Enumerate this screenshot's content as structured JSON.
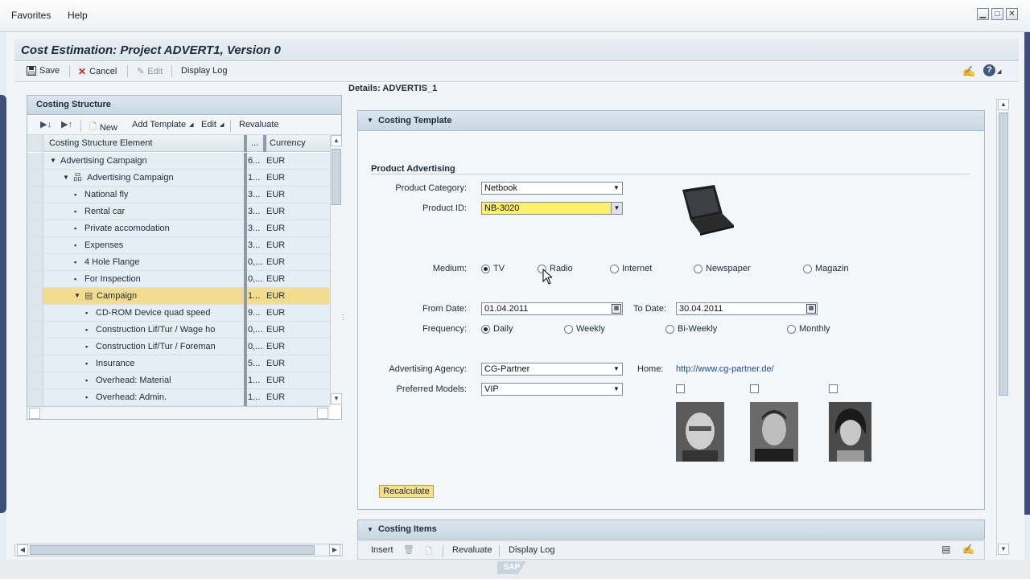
{
  "menu": {
    "favorites": "Favorites",
    "help": "Help"
  },
  "window_controls": {
    "minimize": "▁",
    "maximize": "□",
    "close": "✕"
  },
  "app": {
    "title": "Cost Estimation: Project ADVERT1, Version 0"
  },
  "toolbar": {
    "save": "Save",
    "cancel": "Cancel",
    "edit": "Edit",
    "display_log": "Display Log"
  },
  "costing_structure": {
    "title": "Costing Structure",
    "toolbar": {
      "new": "New",
      "add_template": "Add Template",
      "edit": "Edit",
      "revaluate": "Revaluate"
    },
    "columns": {
      "element": "Costing Structure Element",
      "dots": "...",
      "currency": "Currency"
    },
    "rows": [
      {
        "label": "Advertising Campaign",
        "val": "6...",
        "cur": "EUR"
      },
      {
        "label": "Advertising Campaign",
        "val": "1...",
        "cur": "EUR"
      },
      {
        "label": "National fly",
        "val": "3...",
        "cur": "EUR"
      },
      {
        "label": "Rental car",
        "val": "3...",
        "cur": "EUR"
      },
      {
        "label": "Private accomodation",
        "val": "3...",
        "cur": "EUR"
      },
      {
        "label": "Expenses",
        "val": "3...",
        "cur": "EUR"
      },
      {
        "label": "4 Hole Flange",
        "val": "0,...",
        "cur": "EUR"
      },
      {
        "label": "For Inspection",
        "val": "0,...",
        "cur": "EUR"
      },
      {
        "label": "Campaign",
        "val": "1...",
        "cur": "EUR"
      },
      {
        "label": "CD-ROM Device quad speed",
        "val": "9...",
        "cur": "EUR"
      },
      {
        "label": "Construction Lif/Tur / Wage ho",
        "val": "0,...",
        "cur": "EUR"
      },
      {
        "label": "Construction Lif/Tur / Foreman",
        "val": "0,...",
        "cur": "EUR"
      },
      {
        "label": "Insurance",
        "val": "5...",
        "cur": "EUR"
      },
      {
        "label": "Overhead: Material",
        "val": "1...",
        "cur": "EUR"
      },
      {
        "label": "Overhead: Admin.",
        "val": "1...",
        "cur": "EUR"
      }
    ]
  },
  "details": {
    "title": "Details: ADVERTIS_1",
    "template_section": "Costing Template",
    "group_title": "Product Advertising",
    "product_category_label": "Product Category:",
    "product_category_value": "Netbook",
    "product_id_label": "Product ID:",
    "product_id_value": "NB-3020",
    "medium_label": "Medium:",
    "medium_options": [
      "TV",
      "Radio",
      "Internet",
      "Newspaper",
      "Magazin"
    ],
    "from_date_label": "From Date:",
    "from_date_value": "01.04.2011",
    "to_date_label": "To Date:",
    "to_date_value": "30.04.2011",
    "frequency_label": "Frequency:",
    "frequency_options": [
      "Daily",
      "Weekly",
      "Bi-Weekly",
      "Monthly"
    ],
    "agency_label": "Advertising Agency:",
    "agency_value": "CG-Partner",
    "home_label": "Home:",
    "home_link": "http://www.cg-partner.de/",
    "models_label": "Preferred Models:",
    "models_value": "VIP",
    "recalculate": "Recalculate"
  },
  "costing_items": {
    "title": "Costing Items",
    "toolbar": {
      "insert": "Insert",
      "revaluate": "Revaluate",
      "display_log": "Display Log"
    }
  },
  "colors": {
    "accent": "#f4dc8f",
    "header": "#c9d8e5",
    "link": "#1f4e8c",
    "required_field": "#fff26a"
  }
}
